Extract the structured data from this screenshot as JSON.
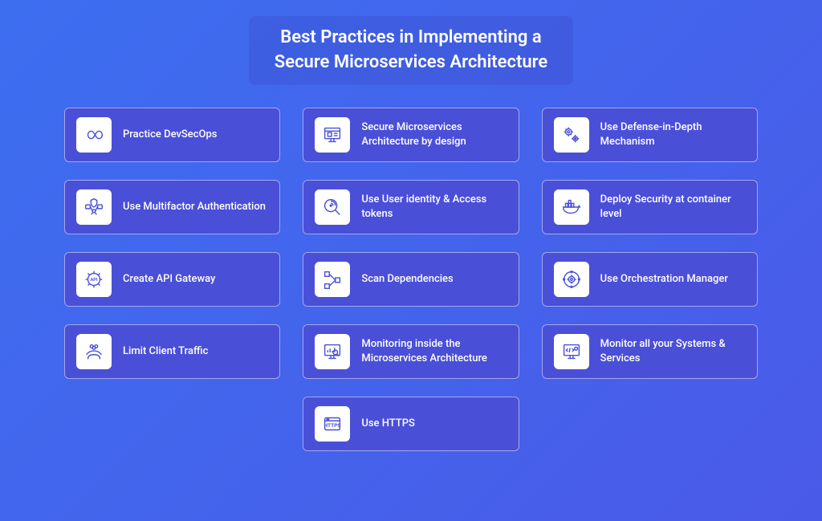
{
  "title_line1": "Best Practices in Implementing a",
  "title_line2": "Secure Microservices Architecture",
  "cards": [
    {
      "label": "Practice DevSecOps",
      "icon": "infinity"
    },
    {
      "label": "Secure Microservices Architecture by design",
      "icon": "monitor-design"
    },
    {
      "label": "Use Defense-in-Depth Mechanism",
      "icon": "gears"
    },
    {
      "label": "Use Multifactor Authentication",
      "icon": "mfa"
    },
    {
      "label": "Use User identity & Access tokens",
      "icon": "fingerprint"
    },
    {
      "label": "Deploy Security at container level",
      "icon": "container"
    },
    {
      "label": "Create API Gateway",
      "icon": "api-gear"
    },
    {
      "label": "Scan Dependencies",
      "icon": "dep-graph"
    },
    {
      "label": "Use Orchestration Manager",
      "icon": "orchestrate"
    },
    {
      "label": "Limit Client Traffic",
      "icon": "hands"
    },
    {
      "label": "Monitoring inside the Microservices Architecture",
      "icon": "monitor-chart"
    },
    {
      "label": "Monitor all your Systems & Services",
      "icon": "monitor-code"
    },
    {
      "label": "Use HTTPS",
      "icon": "https"
    }
  ]
}
